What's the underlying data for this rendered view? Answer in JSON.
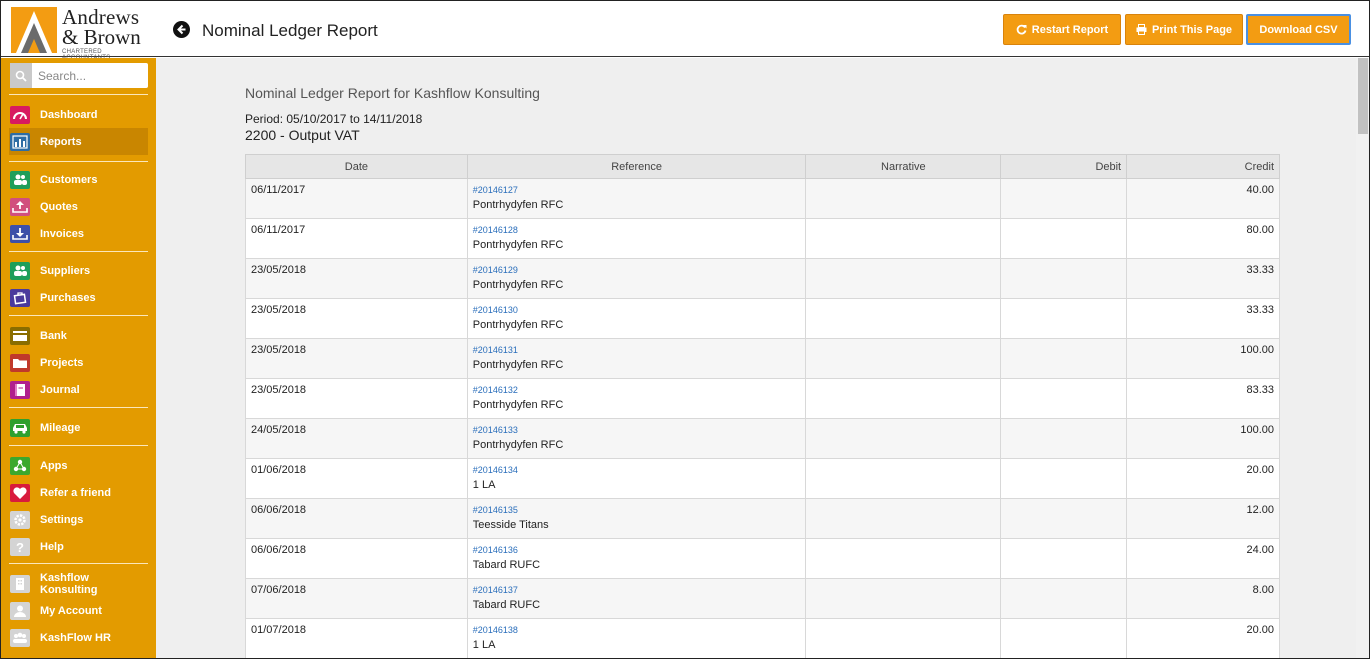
{
  "brand": {
    "line1": "Andrews",
    "line2": "& Brown",
    "line3": "CHARTERED ACCOUNTANTS"
  },
  "header": {
    "title": "Nominal Ledger Report",
    "buttons": {
      "restart": "Restart Report",
      "print": "Print This Page",
      "csv": "Download CSV"
    }
  },
  "sidebar": {
    "search_placeholder": "Search...",
    "items": [
      {
        "label": "Dashboard"
      },
      {
        "label": "Reports"
      },
      {
        "label": "Customers"
      },
      {
        "label": "Quotes"
      },
      {
        "label": "Invoices"
      },
      {
        "label": "Suppliers"
      },
      {
        "label": "Purchases"
      },
      {
        "label": "Bank"
      },
      {
        "label": "Projects"
      },
      {
        "label": "Journal"
      },
      {
        "label": "Mileage"
      },
      {
        "label": "Apps"
      },
      {
        "label": "Refer a friend"
      },
      {
        "label": "Settings"
      },
      {
        "label": "Help"
      },
      {
        "label": "Kashflow Konsulting"
      },
      {
        "label": "My Account"
      },
      {
        "label": "KashFlow HR"
      }
    ]
  },
  "report": {
    "title": "Nominal Ledger Report for Kashflow Konsulting",
    "period": "Period: 05/10/2017 to 14/11/2018",
    "account": "2200 - Output VAT",
    "columns": [
      "Date",
      "Reference",
      "Narrative",
      "Debit",
      "Credit"
    ],
    "rows": [
      {
        "date": "06/11/2017",
        "ref": "#20146127",
        "name": "Pontrhydyfen RFC",
        "narrative": "",
        "debit": "",
        "credit": "40.00"
      },
      {
        "date": "06/11/2017",
        "ref": "#20146128",
        "name": "Pontrhydyfen RFC",
        "narrative": "",
        "debit": "",
        "credit": "80.00"
      },
      {
        "date": "23/05/2018",
        "ref": "#20146129",
        "name": "Pontrhydyfen RFC",
        "narrative": "",
        "debit": "",
        "credit": "33.33"
      },
      {
        "date": "23/05/2018",
        "ref": "#20146130",
        "name": "Pontrhydyfen RFC",
        "narrative": "",
        "debit": "",
        "credit": "33.33"
      },
      {
        "date": "23/05/2018",
        "ref": "#20146131",
        "name": "Pontrhydyfen RFC",
        "narrative": "",
        "debit": "",
        "credit": "100.00"
      },
      {
        "date": "23/05/2018",
        "ref": "#20146132",
        "name": "Pontrhydyfen RFC",
        "narrative": "",
        "debit": "",
        "credit": "83.33"
      },
      {
        "date": "24/05/2018",
        "ref": "#20146133",
        "name": "Pontrhydyfen RFC",
        "narrative": "",
        "debit": "",
        "credit": "100.00"
      },
      {
        "date": "01/06/2018",
        "ref": "#20146134",
        "name": "1 LA",
        "narrative": "",
        "debit": "",
        "credit": "20.00"
      },
      {
        "date": "06/06/2018",
        "ref": "#20146135",
        "name": "Teesside Titans",
        "narrative": "",
        "debit": "",
        "credit": "12.00"
      },
      {
        "date": "06/06/2018",
        "ref": "#20146136",
        "name": "Tabard RUFC",
        "narrative": "",
        "debit": "",
        "credit": "24.00"
      },
      {
        "date": "07/06/2018",
        "ref": "#20146137",
        "name": "Tabard RUFC",
        "narrative": "",
        "debit": "",
        "credit": "8.00"
      },
      {
        "date": "01/07/2018",
        "ref": "#20146138",
        "name": "1 LA",
        "narrative": "",
        "debit": "",
        "credit": "20.00"
      }
    ]
  }
}
